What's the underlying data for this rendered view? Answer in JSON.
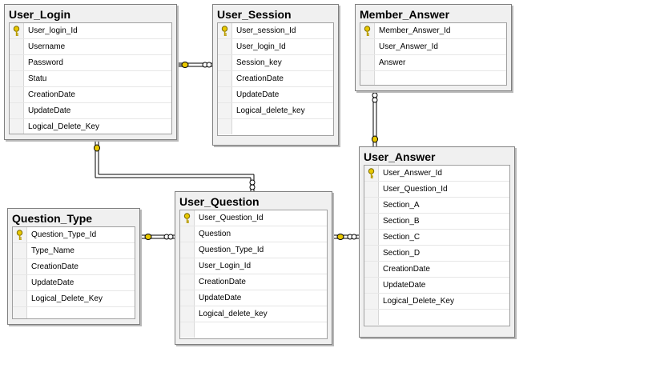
{
  "tables": {
    "user_login": {
      "name": "User_Login",
      "columns": [
        "User_login_Id",
        "Username",
        "Password",
        "Statu",
        "CreationDate",
        "UpdateDate",
        "Logical_Delete_Key"
      ]
    },
    "user_session": {
      "name": "User_Session",
      "columns": [
        "User_session_Id",
        "User_login_Id",
        "Session_key",
        "CreationDate",
        "UpdateDate",
        "Logical_delete_key"
      ]
    },
    "member_answer": {
      "name": "Member_Answer",
      "columns": [
        "Member_Answer_Id",
        "User_Answer_Id",
        "Answer"
      ]
    },
    "user_answer": {
      "name": "User_Answer",
      "columns": [
        "User_Answer_Id",
        "User_Question_Id",
        "Section_A",
        "Section_B",
        "Section_C",
        "Section_D",
        "CreationDate",
        "UpdateDate",
        "Logical_Delete_Key"
      ]
    },
    "question_type": {
      "name": "Question_Type",
      "columns": [
        "Question_Type_Id",
        "Type_Name",
        "CreationDate",
        "UpdateDate",
        "Logical_Delete_Key"
      ]
    },
    "user_question": {
      "name": "User_Question",
      "columns": [
        "User_Question_Id",
        "Question",
        "Question_Type_Id",
        "User_Login_Id",
        "CreationDate",
        "UpdateDate",
        "Logical_delete_key"
      ]
    }
  },
  "relationships": [
    {
      "from": "user_login",
      "to": "user_session"
    },
    {
      "from": "user_login",
      "to": "user_question"
    },
    {
      "from": "user_answer",
      "to": "member_answer"
    },
    {
      "from": "question_type",
      "to": "user_question"
    },
    {
      "from": "user_question",
      "to": "user_answer"
    }
  ],
  "colors": {
    "key": "#e8c800",
    "line": "#000000",
    "table_bg": "#f0f0f0"
  }
}
